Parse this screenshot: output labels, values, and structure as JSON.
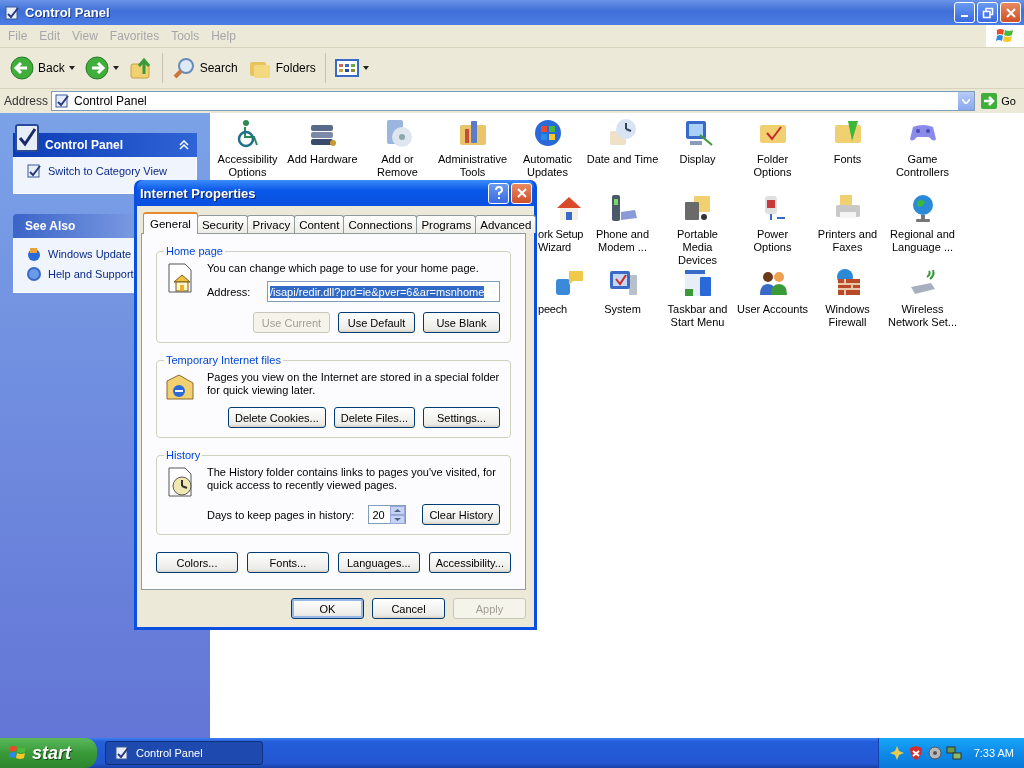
{
  "window": {
    "title": "Control Panel"
  },
  "menu": [
    "File",
    "Edit",
    "View",
    "Favorites",
    "Tools",
    "Help"
  ],
  "toolbar": [
    {
      "kind": "back",
      "label": "Back"
    },
    {
      "kind": "forward"
    },
    {
      "kind": "up"
    },
    {
      "kind": "search",
      "label": "Search"
    },
    {
      "kind": "folders",
      "label": "Folders"
    },
    {
      "kind": "views"
    }
  ],
  "address": {
    "label": "Address",
    "value": "Control Panel",
    "go": "Go"
  },
  "sidebar": [
    {
      "kind": "main",
      "title": "Control Panel",
      "items": [
        "Switch to Category View"
      ]
    },
    {
      "kind": "see_also",
      "title": "See Also",
      "items": [
        "Windows Update",
        "Help and Support"
      ]
    }
  ],
  "icon_rows": [
    [
      {
        "label": "Accessibility Options"
      },
      {
        "label": "Add Hardware"
      },
      {
        "label": "Add or Remove"
      },
      {
        "label": "Administrative Tools"
      },
      {
        "label": "Automatic Updates"
      },
      {
        "label": "Date and Time"
      },
      {
        "label": "Display"
      },
      {
        "label": "Folder Options"
      },
      {
        "label": "Fonts"
      },
      {
        "label": "Game Controllers"
      }
    ],
    [
      {
        "label": "ork Setup Wizard",
        "kind": "partial"
      },
      {
        "label": "Phone and Modem ..."
      },
      {
        "label": "Portable Media Devices"
      },
      {
        "label": "Power Options"
      },
      {
        "label": "Printers and Faxes"
      },
      {
        "label": "Regional and Language ..."
      }
    ],
    [
      {
        "label": "peech",
        "kind": "partial"
      },
      {
        "label": "System"
      },
      {
        "label": "Taskbar and Start Menu"
      },
      {
        "label": "User Accounts"
      },
      {
        "label": "Windows Firewall"
      },
      {
        "label": "Wireless Network Set..."
      }
    ]
  ],
  "dialog": {
    "title": "Internet Properties",
    "tabs": [
      {
        "label": "General",
        "selected": true
      },
      {
        "label": "Security",
        "selected": false
      },
      {
        "label": "Privacy",
        "selected": false
      },
      {
        "label": "Content",
        "selected": false
      },
      {
        "label": "Connections",
        "selected": false
      },
      {
        "label": "Programs",
        "selected": false
      },
      {
        "label": "Advanced",
        "selected": false
      }
    ],
    "groups": [
      {
        "kind": "home",
        "title": "Home page",
        "text": "You can change which page to use for your home page.",
        "field_label": "Address:",
        "field_value": "/isapi/redir.dll?prd=ie&pver=6&ar=msnhome",
        "value_selected": true,
        "buttons": [
          {
            "label": "Use Current",
            "disabled": true
          },
          {
            "label": "Use Default",
            "disabled": false
          },
          {
            "label": "Use Blank",
            "disabled": false
          }
        ]
      },
      {
        "kind": "temp",
        "title": "Temporary Internet files",
        "text": "Pages you view on the Internet are stored in a special folder for quick viewing later.",
        "buttons": [
          {
            "label": "Delete Cookies...",
            "disabled": false
          },
          {
            "label": "Delete Files...",
            "disabled": false
          },
          {
            "label": "Settings...",
            "disabled": false
          }
        ]
      },
      {
        "kind": "history",
        "title": "History",
        "text": "The History folder contains links to pages you've visited, for quick access to recently viewed pages.",
        "field_label": "Days to keep pages in history:",
        "field_value": "20",
        "buttons": [
          {
            "label": "Clear History",
            "disabled": false
          }
        ]
      }
    ],
    "extra_buttons": [
      "Colors...",
      "Fonts...",
      "Languages...",
      "Accessibility..."
    ],
    "footer_buttons": [
      {
        "label": "OK",
        "disabled": false,
        "default": true
      },
      {
        "label": "Cancel",
        "disabled": false,
        "default": false
      },
      {
        "label": "Apply",
        "disabled": true,
        "default": false
      }
    ]
  },
  "taskbar": {
    "start": "start",
    "tasks": [
      {
        "label": "Control Panel",
        "selected": true
      }
    ],
    "clock": "7:33 AM"
  }
}
